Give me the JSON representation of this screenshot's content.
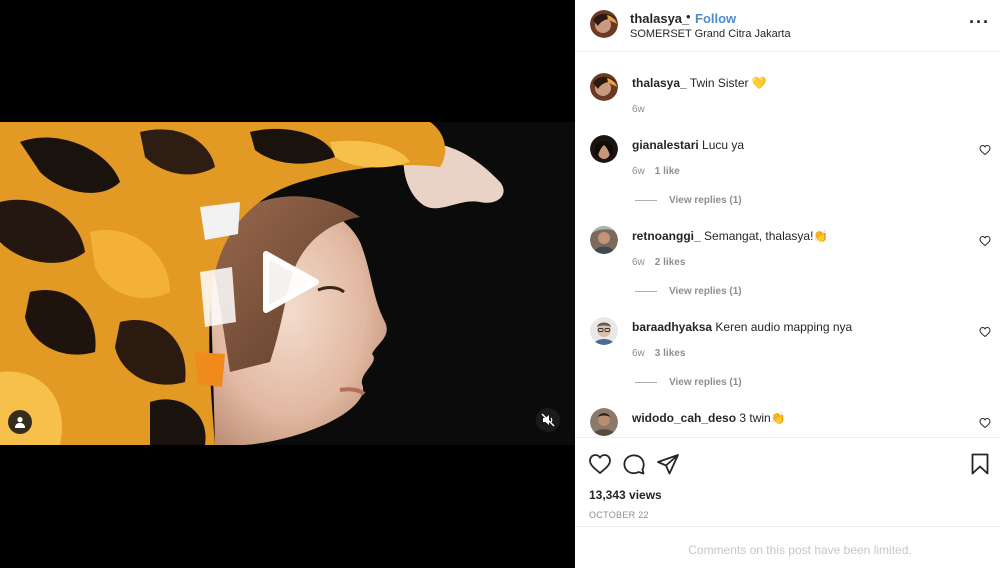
{
  "post": {
    "author": "thalasya_",
    "separator": "•",
    "follow_label": "Follow",
    "location": "SOMERSET Grand Citra Jakarta",
    "more_icon": "more-horizontal-icon"
  },
  "caption": {
    "user": "thalasya_",
    "text": "Twin Sister 💛",
    "time": "6w"
  },
  "comments": [
    {
      "user": "gianalestari",
      "text": "Lucu ya",
      "time": "6w",
      "likes": "1 like",
      "replies": "View replies (1)"
    },
    {
      "user": "retnoanggi_",
      "text": "Semangat, thalasya!👏",
      "time": "6w",
      "likes": "2 likes",
      "replies": "View replies (1)"
    },
    {
      "user": "baraadhyaksa",
      "text": "Keren audio mapping nya",
      "time": "6w",
      "likes": "3 likes",
      "replies": "View replies (1)"
    },
    {
      "user": "widodo_cah_deso",
      "text": "3 twin👏"
    }
  ],
  "stats": {
    "views": "13,343 views",
    "date": "OCTOBER 22"
  },
  "footer": {
    "limited_text": "Comments on this post have been limited."
  },
  "colors": {
    "follow": "#4f8bc9",
    "muted_text": "#8e8e8e",
    "border": "#efefef"
  }
}
